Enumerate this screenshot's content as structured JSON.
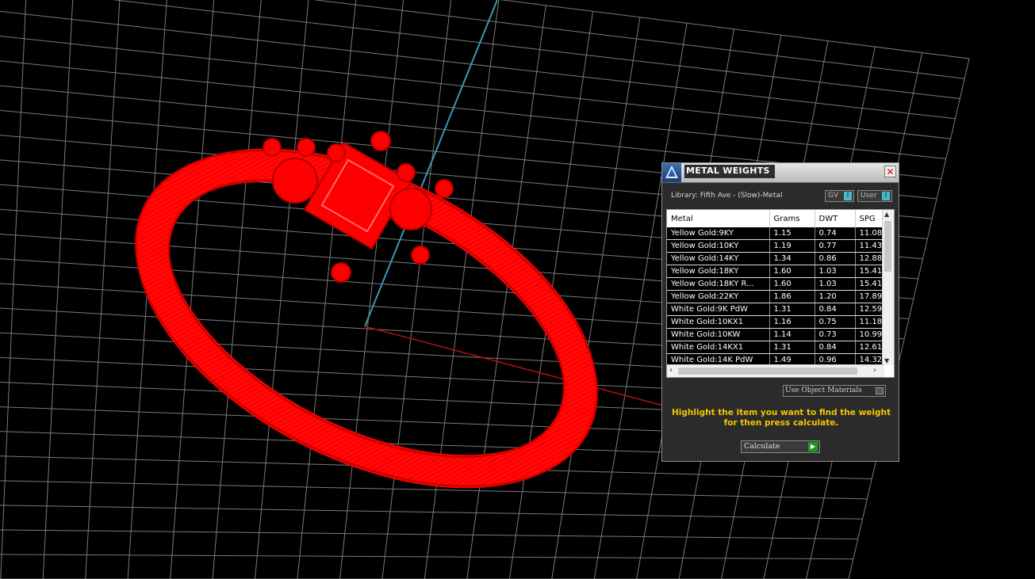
{
  "viewport": {
    "grid_color": "#7a7a7a",
    "ring_color": "#ff0000",
    "axis_y_color": "#3a9ab5",
    "axis_x_color": "#b01010"
  },
  "dialog": {
    "title": "METAL WEIGHTS",
    "library": "Library: Fifth Ave - (Slow)-Metal",
    "toggle_gv": "GV",
    "toggle_user": "User",
    "toggle_indicator": "I",
    "columns": [
      "Metal",
      "Grams",
      "DWT",
      "SPG"
    ],
    "rows": [
      [
        "Yellow Gold:9KY",
        "1.15",
        "0.74",
        "11.08"
      ],
      [
        "Yellow Gold:10KY",
        "1.19",
        "0.77",
        "11.43"
      ],
      [
        "Yellow Gold:14KY",
        "1.34",
        "0.86",
        "12.88"
      ],
      [
        "Yellow Gold:18KY",
        "1.60",
        "1.03",
        "15.41"
      ],
      [
        "Yellow Gold:18KY R...",
        "1.60",
        "1.03",
        "15.41"
      ],
      [
        "Yellow Gold:22KY",
        "1.86",
        "1.20",
        "17.89"
      ],
      [
        "White Gold:9K PdW",
        "1.31",
        "0.84",
        "12.59"
      ],
      [
        "White Gold:10KX1",
        "1.16",
        "0.75",
        "11.18"
      ],
      [
        "White Gold:10KW",
        "1.14",
        "0.73",
        "10.99"
      ],
      [
        "White Gold:14KX1",
        "1.31",
        "0.84",
        "12.61"
      ],
      [
        "White Gold:14K PdW",
        "1.49",
        "0.96",
        "14.32"
      ]
    ],
    "use_object_materials": "Use Object Materials",
    "instruction": "Highlight the item you want to find the weight for then press calculate.",
    "calculate": "Calculate",
    "accent_color": "#f5c400"
  }
}
